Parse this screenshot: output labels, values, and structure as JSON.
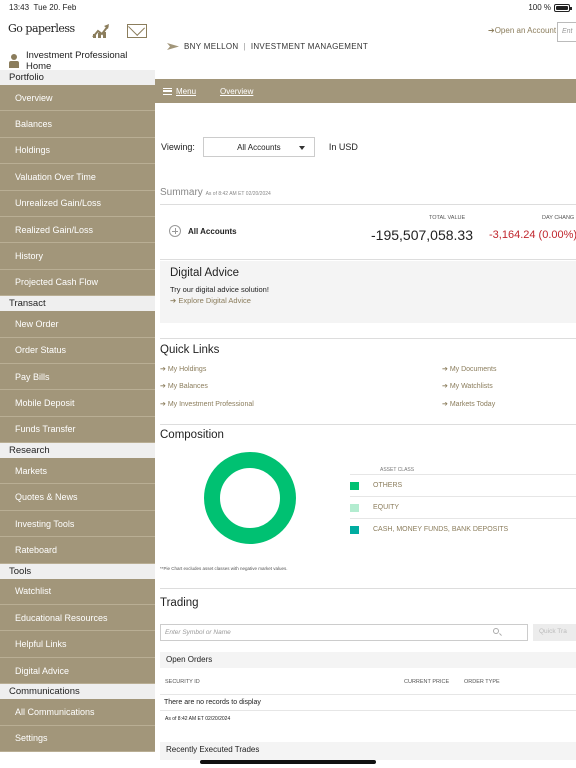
{
  "status": {
    "time": "13:43",
    "date": "Tue 20. Feb",
    "battery": "100 %"
  },
  "sidebar": {
    "go_paperless": "Go paperless",
    "investment_home": "Investment Professional Home",
    "sections": [
      {
        "title": "Portfolio",
        "items": [
          "Overview",
          "Balances",
          "Holdings",
          "Valuation Over Time",
          "Unrealized Gain/Loss",
          "Realized Gain/Loss",
          "History",
          "Projected Cash Flow"
        ]
      },
      {
        "title": "Transact",
        "items": [
          "New Order",
          "Order Status",
          "Pay Bills",
          "Mobile Deposit",
          "Funds Transfer"
        ]
      },
      {
        "title": "Research",
        "items": [
          "Markets",
          "Quotes & News",
          "Investing Tools",
          "Rateboard"
        ]
      },
      {
        "title": "Tools",
        "items": [
          "Watchlist",
          "Educational Resources",
          "Helpful Links",
          "Digital Advice"
        ]
      },
      {
        "title": "Communications",
        "items": [
          "All Communications",
          "Settings"
        ]
      }
    ]
  },
  "header": {
    "brand": "BNY MELLON",
    "brand_sub": "INVESTMENT MANAGEMENT",
    "open_account": "Open an Account",
    "enter_placeholder": "Ent",
    "menu": "Menu",
    "overview": "Overview"
  },
  "viewing": {
    "label": "Viewing:",
    "selected": "All Accounts",
    "currency": "In USD"
  },
  "summary": {
    "title": "Summary",
    "asof": "As of 8:42 AM ET 02/20/2024",
    "account": "All Accounts",
    "total_value_label": "TOTAL VALUE",
    "total_value": "-195,507,058.33",
    "day_change_label": "DAY CHANG",
    "day_change": "-3,164.24 (0.00%)"
  },
  "digital_advice": {
    "title": "Digital Advice",
    "text": "Try our digital advice solution!",
    "link": "Explore Digital Advice"
  },
  "quick_links": {
    "title": "Quick Links",
    "left": [
      "My Holdings",
      "My Balances",
      "My Investment Professional"
    ],
    "right": [
      "My Documents",
      "My Watchlists",
      "Markets Today"
    ]
  },
  "composition": {
    "title": "Composition",
    "asset_class_label": "ASSET CLASS",
    "classes": [
      {
        "name": "OTHERS",
        "color": "#00c172"
      },
      {
        "name": "EQUITY",
        "color": "#b3ecd0"
      },
      {
        "name": "CASH, MONEY FUNDS, BANK DEPOSITS",
        "color": "#00aca0"
      }
    ],
    "donut_color": "#00c172",
    "footnote": "**Pie Chart excludes asset classes with negative market values."
  },
  "trading": {
    "title": "Trading",
    "symbol_placeholder": "Enter Symbol or Name",
    "quick_trade": "Quick Tra",
    "open_orders": "Open Orders",
    "columns": [
      "SECURITY ID",
      "CURRENT PRICE",
      "ORDER TYPE"
    ],
    "no_records": "There are no records to display",
    "asof": "As of 8:42 AM ET 02/20/2024",
    "recent": "Recently Executed Trades"
  }
}
